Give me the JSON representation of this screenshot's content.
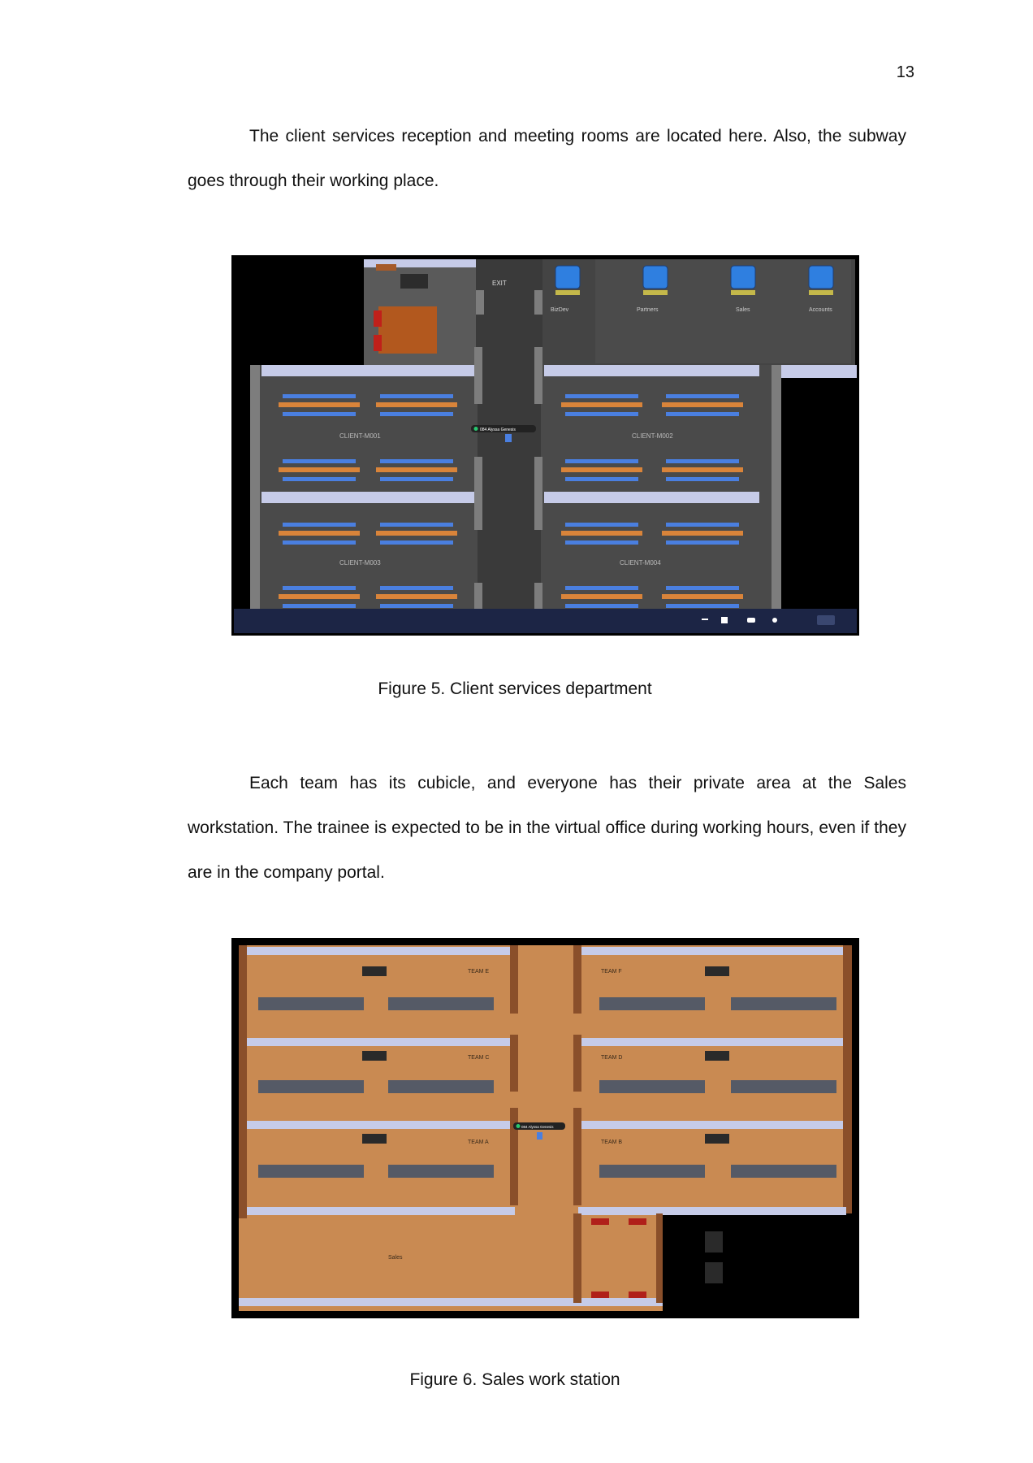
{
  "page_number": "13",
  "paragraphs": {
    "p1": "The client services reception and meeting rooms are located here. Also, the subway goes through their working place.",
    "p2": "Each team has its cubicle, and everyone has their private area at the Sales workstation. The trainee is expected to be in the virtual office during working hours, even if they are in the company portal."
  },
  "figure5": {
    "caption": "Figure 5. Client services department",
    "labels": {
      "exit": "EXIT",
      "bizdev": "BizDev",
      "partners": "Partners",
      "sales": "Sales",
      "accounts": "Accounts",
      "room1": "CLIENT-M001",
      "room2": "CLIENT-M002",
      "room3": "CLIENT-M003",
      "room4": "CLIENT-M004",
      "avatar": "084 Alyssa Genesis"
    },
    "colors": {
      "floor": "#4a4a4a",
      "wall": "#7d7d7d",
      "toolbar": "#1c2545",
      "chair": "#4a7fe0",
      "table": "#d9843a"
    }
  },
  "figure6": {
    "caption": "Figure 6. Sales work station",
    "labels": {
      "team_e": "TEAM E",
      "team_f": "TEAM F",
      "team_c": "TEAM C",
      "team_d": "TEAM D",
      "team_a": "TEAM A",
      "team_b": "TEAM B",
      "sales": "Sales",
      "avatar": "084 Alyssa Genesis"
    },
    "colors": {
      "floor": "#c98a52",
      "wall": "#8a4f2a",
      "desk": "#555a66"
    }
  }
}
